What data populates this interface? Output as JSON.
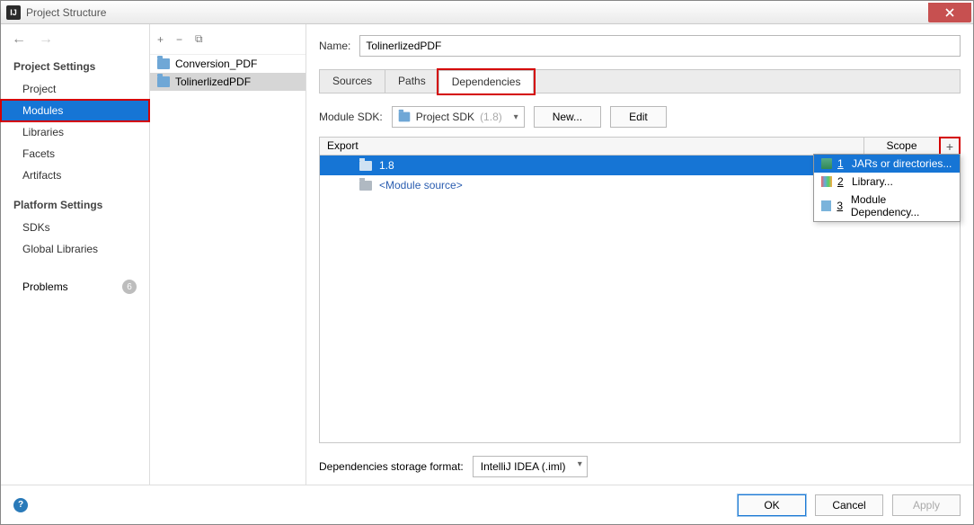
{
  "window": {
    "title": "Project Structure"
  },
  "sidebar": {
    "group1": "Project Settings",
    "items1": [
      "Project",
      "Modules",
      "Libraries",
      "Facets",
      "Artifacts"
    ],
    "group2": "Platform Settings",
    "items2": [
      "SDKs",
      "Global Libraries"
    ],
    "problems_label": "Problems",
    "problems_count": "6"
  },
  "modules": {
    "items": [
      "Conversion_PDF",
      "TolinerlizedPDF"
    ]
  },
  "main": {
    "name_label": "Name:",
    "name_value": "TolinerlizedPDF",
    "tabs": [
      "Sources",
      "Paths",
      "Dependencies"
    ],
    "sdk_label": "Module SDK:",
    "sdk_value": "Project SDK",
    "sdk_version": "(1.8)",
    "new_btn": "New...",
    "edit_btn": "Edit",
    "export_header": "Export",
    "scope_header": "Scope",
    "dep_items": {
      "row1": "1.8",
      "row2": "<Module source>"
    },
    "storage_label": "Dependencies storage format:",
    "storage_value": "IntelliJ IDEA (.iml)"
  },
  "popup": {
    "items": [
      {
        "n": "1",
        "label": "JARs or directories..."
      },
      {
        "n": "2",
        "label": "Library..."
      },
      {
        "n": "3",
        "label": "Module Dependency..."
      }
    ]
  },
  "footer": {
    "ok": "OK",
    "cancel": "Cancel",
    "apply": "Apply"
  }
}
